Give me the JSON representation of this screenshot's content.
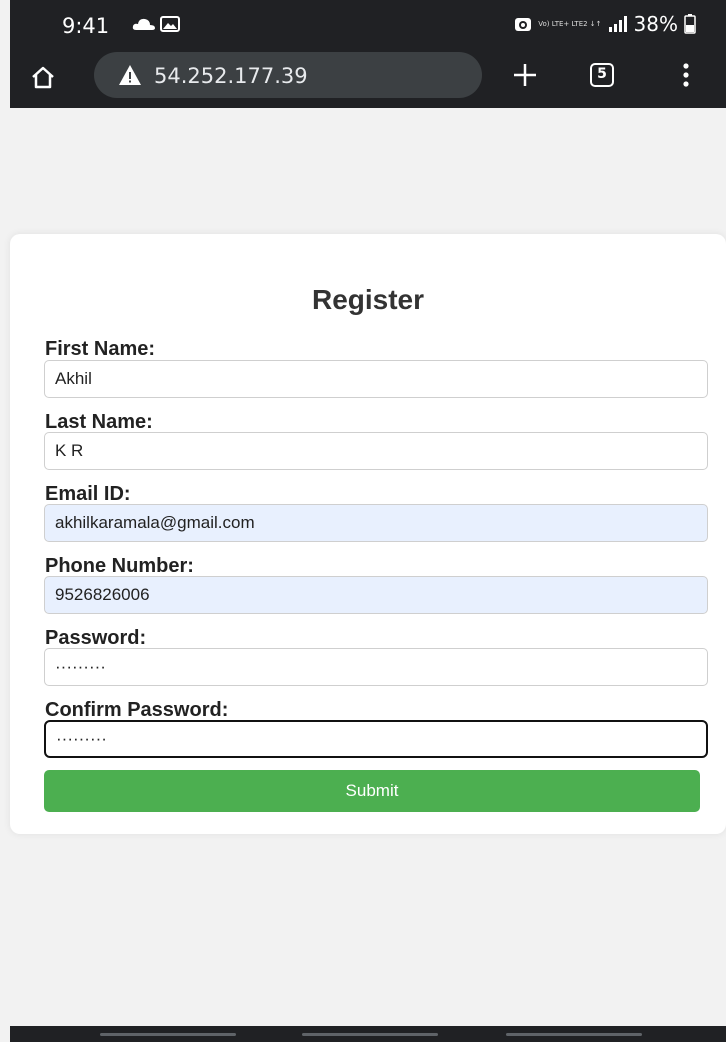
{
  "status_bar": {
    "time": "9:41",
    "network": "Vo) LTE+ LTE2 ↓↑",
    "battery": "38%",
    "icons": [
      "cloud-icon",
      "gallery-icon",
      "alarm-icon",
      "signal-icon",
      "battery-icon"
    ]
  },
  "browser": {
    "url": "54.252.177.39",
    "tab_count": "5",
    "icons": [
      "home-icon",
      "not-secure-warning-icon",
      "new-tab-plus-icon",
      "more-menu-icon"
    ]
  },
  "form": {
    "title": "Register",
    "fields": [
      {
        "label": "First Name:",
        "value": "Akhil",
        "autofilled": false
      },
      {
        "label": "Last Name:",
        "value": "K R",
        "autofilled": false
      },
      {
        "label": "Email ID:",
        "value": "akhilkaramala@gmail.com",
        "autofilled": true
      },
      {
        "label": "Phone Number:",
        "value": "9526826006",
        "autofilled": true
      },
      {
        "label": "Password:",
        "value": "·········",
        "autofilled": false
      },
      {
        "label": "Confirm Password:",
        "value": "·········",
        "autofilled": false
      }
    ],
    "submit_label": "Submit"
  },
  "colors": {
    "submit": "#4caf50",
    "autofill": "#e8f0fe",
    "chrome": "#202124"
  }
}
